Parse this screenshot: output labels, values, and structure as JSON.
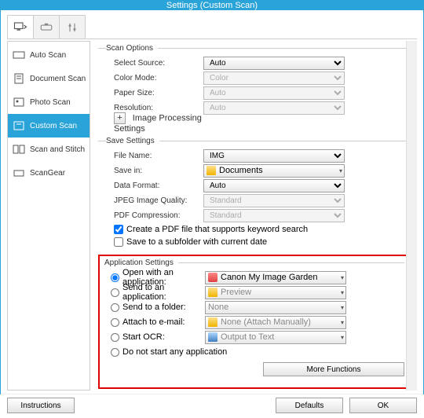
{
  "title": "Settings (Custom Scan)",
  "sidebar": {
    "items": [
      {
        "label": "Auto Scan"
      },
      {
        "label": "Document Scan"
      },
      {
        "label": "Photo Scan"
      },
      {
        "label": "Custom Scan"
      },
      {
        "label": "Scan and Stitch"
      },
      {
        "label": "ScanGear"
      }
    ]
  },
  "scan_options": {
    "legend": "Scan Options",
    "select_source_label": "Select Source:",
    "select_source_value": "Auto",
    "color_mode_label": "Color Mode:",
    "color_mode_value": "Color",
    "paper_size_label": "Paper Size:",
    "paper_size_value": "Auto",
    "resolution_label": "Resolution:",
    "resolution_value": "Auto",
    "expand_label": "Image Processing Settings"
  },
  "save_settings": {
    "legend": "Save Settings",
    "file_name_label": "File Name:",
    "file_name_value": "IMG",
    "save_in_label": "Save in:",
    "save_in_value": "Documents",
    "data_format_label": "Data Format:",
    "data_format_value": "Auto",
    "jpeg_label": "JPEG Image Quality:",
    "jpeg_value": "Standard",
    "pdf_label": "PDF Compression:",
    "pdf_value": "Standard",
    "chk_keyword": "Create a PDF file that supports keyword search",
    "chk_subfolder": "Save to a subfolder with current date"
  },
  "app_settings": {
    "legend": "Application Settings",
    "open_app_label": "Open with an application:",
    "open_app_value": "Canon My Image Garden",
    "send_app_label": "Send to an application:",
    "send_app_value": "Preview",
    "send_folder_label": "Send to a folder:",
    "send_folder_value": "None",
    "attach_label": "Attach to e-mail:",
    "attach_value": "None (Attach Manually)",
    "ocr_label": "Start OCR:",
    "ocr_value": "Output to Text",
    "none_label": "Do not start any application",
    "more_fn": "More Functions"
  },
  "footer": {
    "instructions": "Instructions",
    "defaults": "Defaults",
    "ok": "OK"
  }
}
